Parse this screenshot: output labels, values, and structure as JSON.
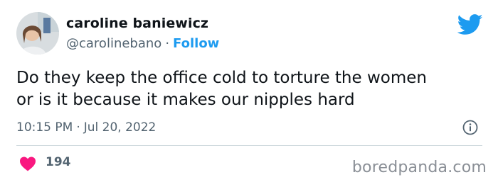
{
  "author": {
    "name": "caroline baniewicz",
    "handle": "@carolinebano",
    "separator": "·",
    "follow_label": "Follow"
  },
  "tweet": {
    "text_line_1": "Do they keep the office cold to torture the women",
    "text_line_2": "or is it because it makes our nipples hard",
    "time": "10:15 PM",
    "separator": "·",
    "date": "Jul 20, 2022"
  },
  "engagement": {
    "likes": "194"
  },
  "watermark": "boredpanda.com",
  "icons": {
    "brand": "twitter-bird-icon",
    "info": "info-icon",
    "like": "heart-icon"
  },
  "colors": {
    "accent": "#1d9bf0",
    "heart": "#f91880",
    "secondary_text": "#536471"
  }
}
